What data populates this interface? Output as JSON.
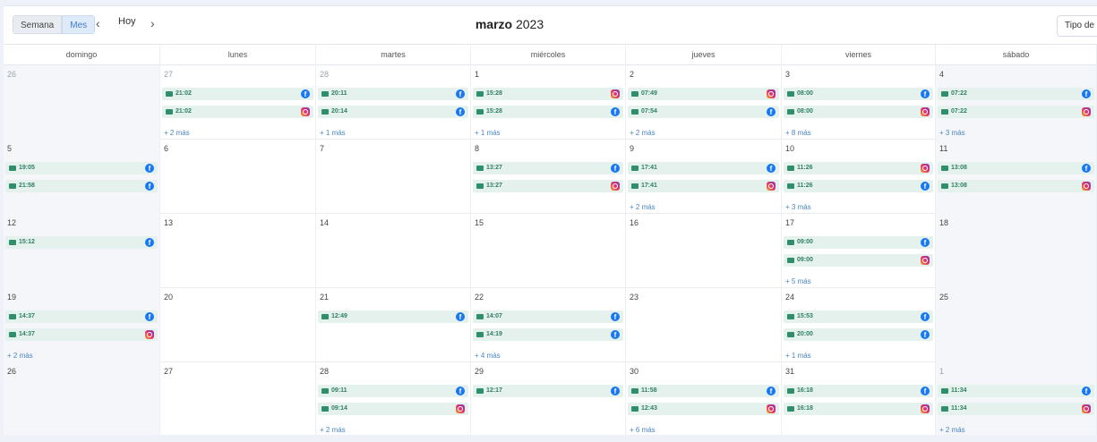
{
  "toolbar": {
    "view_week": "Semana",
    "view_month": "Mes",
    "prev_icon": "chevron-left-icon",
    "today": "Hoy",
    "next_icon": "chevron-right-icon",
    "title_month": "marzo",
    "title_year": "2023",
    "type_button": "Tipo de"
  },
  "colors": {
    "event_bg": "#e4f1ec",
    "event_text": "#2f7f62",
    "facebook": "#1877f2",
    "more_link": "#4a86c5",
    "accent": "#3a7bd5"
  },
  "day_headers": [
    "domingo",
    "lunes",
    "martes",
    "miércoles",
    "jueves",
    "viernes",
    "sábado"
  ],
  "weeks": [
    {
      "days": [
        {
          "num": "26",
          "other": true,
          "shaded": true,
          "events": [],
          "more": ""
        },
        {
          "num": "27",
          "other": true,
          "events": [
            {
              "time": "21:02",
              "net": "facebook"
            },
            {
              "time": "21:02",
              "net": "instagram"
            }
          ],
          "more": "+ 2 más"
        },
        {
          "num": "28",
          "other": true,
          "events": [
            {
              "time": "20:11",
              "net": "facebook"
            },
            {
              "time": "20:14",
              "net": "facebook"
            }
          ],
          "more": "+ 1 más"
        },
        {
          "num": "1",
          "events": [
            {
              "time": "15:28",
              "net": "instagram"
            },
            {
              "time": "15:28",
              "net": "facebook"
            }
          ],
          "more": "+ 1 más"
        },
        {
          "num": "2",
          "events": [
            {
              "time": "07:49",
              "net": "instagram"
            },
            {
              "time": "07:54",
              "net": "facebook"
            }
          ],
          "more": "+ 2 más"
        },
        {
          "num": "3",
          "events": [
            {
              "time": "08:00",
              "net": "facebook"
            },
            {
              "time": "08:00",
              "net": "instagram"
            }
          ],
          "more": "+ 8 más"
        },
        {
          "num": "4",
          "shaded": true,
          "events": [
            {
              "time": "07:22",
              "net": "facebook"
            },
            {
              "time": "07:22",
              "net": "instagram"
            }
          ],
          "more": "+ 3 más"
        }
      ]
    },
    {
      "days": [
        {
          "num": "5",
          "shaded": true,
          "events": [
            {
              "time": "19:05",
              "net": "facebook"
            },
            {
              "time": "21:58",
              "net": "facebook"
            }
          ],
          "more": ""
        },
        {
          "num": "6",
          "events": [],
          "more": ""
        },
        {
          "num": "7",
          "events": [],
          "more": ""
        },
        {
          "num": "8",
          "events": [
            {
              "time": "13:27",
              "net": "facebook"
            },
            {
              "time": "13:27",
              "net": "instagram"
            }
          ],
          "more": ""
        },
        {
          "num": "9",
          "events": [
            {
              "time": "17:41",
              "net": "facebook"
            },
            {
              "time": "17:41",
              "net": "instagram"
            }
          ],
          "more": "+ 2 más"
        },
        {
          "num": "10",
          "events": [
            {
              "time": "11:26",
              "net": "instagram"
            },
            {
              "time": "11:26",
              "net": "facebook"
            }
          ],
          "more": "+ 3 más"
        },
        {
          "num": "11",
          "shaded": true,
          "events": [
            {
              "time": "13:08",
              "net": "facebook"
            },
            {
              "time": "13:08",
              "net": "instagram"
            }
          ],
          "more": ""
        }
      ]
    },
    {
      "days": [
        {
          "num": "12",
          "shaded": true,
          "events": [
            {
              "time": "15:12",
              "net": "facebook"
            }
          ],
          "more": ""
        },
        {
          "num": "13",
          "events": [],
          "more": ""
        },
        {
          "num": "14",
          "events": [],
          "more": ""
        },
        {
          "num": "15",
          "events": [],
          "more": ""
        },
        {
          "num": "16",
          "events": [],
          "more": ""
        },
        {
          "num": "17",
          "events": [
            {
              "time": "09:00",
              "net": "facebook"
            },
            {
              "time": "09:00",
              "net": "instagram"
            }
          ],
          "more": "+ 5 más"
        },
        {
          "num": "18",
          "shaded": true,
          "events": [],
          "more": ""
        }
      ]
    },
    {
      "days": [
        {
          "num": "19",
          "shaded": true,
          "events": [
            {
              "time": "14:37",
              "net": "facebook"
            },
            {
              "time": "14:37",
              "net": "instagram"
            }
          ],
          "more": "+ 2 más"
        },
        {
          "num": "20",
          "events": [],
          "more": ""
        },
        {
          "num": "21",
          "events": [
            {
              "time": "12:49",
              "net": "facebook"
            }
          ],
          "more": ""
        },
        {
          "num": "22",
          "events": [
            {
              "time": "14:07",
              "net": "facebook"
            },
            {
              "time": "14:19",
              "net": "facebook"
            }
          ],
          "more": "+ 4 más"
        },
        {
          "num": "23",
          "events": [],
          "more": ""
        },
        {
          "num": "24",
          "events": [
            {
              "time": "15:53",
              "net": "facebook"
            },
            {
              "time": "20:00",
              "net": "facebook"
            }
          ],
          "more": "+ 1 más"
        },
        {
          "num": "25",
          "shaded": true,
          "events": [],
          "more": ""
        }
      ]
    },
    {
      "days": [
        {
          "num": "26",
          "shaded": true,
          "events": [],
          "more": ""
        },
        {
          "num": "27",
          "events": [],
          "more": ""
        },
        {
          "num": "28",
          "events": [
            {
              "time": "09:11",
              "net": "facebook"
            },
            {
              "time": "09:14",
              "net": "instagram"
            }
          ],
          "more": "+ 2 más"
        },
        {
          "num": "29",
          "events": [
            {
              "time": "12:17",
              "net": "facebook"
            }
          ],
          "more": ""
        },
        {
          "num": "30",
          "events": [
            {
              "time": "11:58",
              "net": "facebook"
            },
            {
              "time": "12:43",
              "net": "instagram"
            }
          ],
          "more": "+ 6 más"
        },
        {
          "num": "31",
          "events": [
            {
              "time": "16:18",
              "net": "facebook"
            },
            {
              "time": "16:18",
              "net": "instagram"
            }
          ],
          "more": ""
        },
        {
          "num": "1",
          "other": true,
          "shaded": true,
          "events": [
            {
              "time": "11:34",
              "net": "facebook"
            },
            {
              "time": "11:34",
              "net": "instagram"
            }
          ],
          "more": "+ 2 más"
        }
      ]
    }
  ]
}
